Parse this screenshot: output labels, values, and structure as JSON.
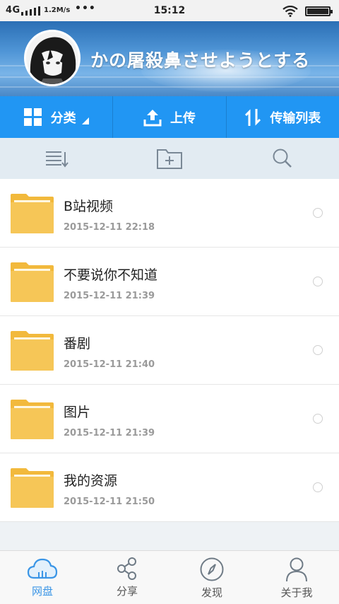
{
  "status_bar": {
    "network": "4G",
    "speed": "1.2M/s",
    "more": "•••",
    "time": "15:12"
  },
  "header": {
    "username": "かの屠殺鼻させようとする"
  },
  "actions": [
    {
      "label": "分类",
      "icon": "grid-icon"
    },
    {
      "label": "上传",
      "icon": "upload-icon"
    },
    {
      "label": "传输列表",
      "icon": "transfer-icon"
    }
  ],
  "toolbar": {
    "icons": [
      "sort-list-icon",
      "new-folder-icon",
      "search-icon"
    ]
  },
  "files": [
    {
      "name": "B站视频",
      "date": "2015-12-11  22:18"
    },
    {
      "name": "不要说你不知道",
      "date": "2015-12-11  21:39"
    },
    {
      "name": "番剧",
      "date": "2015-12-11  21:40"
    },
    {
      "name": "图片",
      "date": "2015-12-11  21:39"
    },
    {
      "name": "我的资源",
      "date": "2015-12-11  21:50"
    }
  ],
  "bottom_nav": [
    {
      "label": "网盘",
      "icon": "cloud-icon",
      "active": true
    },
    {
      "label": "分享",
      "icon": "share-icon",
      "active": false
    },
    {
      "label": "发现",
      "icon": "compass-icon",
      "active": false
    },
    {
      "label": "关于我",
      "icon": "person-icon",
      "active": false
    }
  ],
  "colors": {
    "accent": "#2196f3",
    "folder": "#f5c24a",
    "active_nav": "#3a95e6"
  }
}
